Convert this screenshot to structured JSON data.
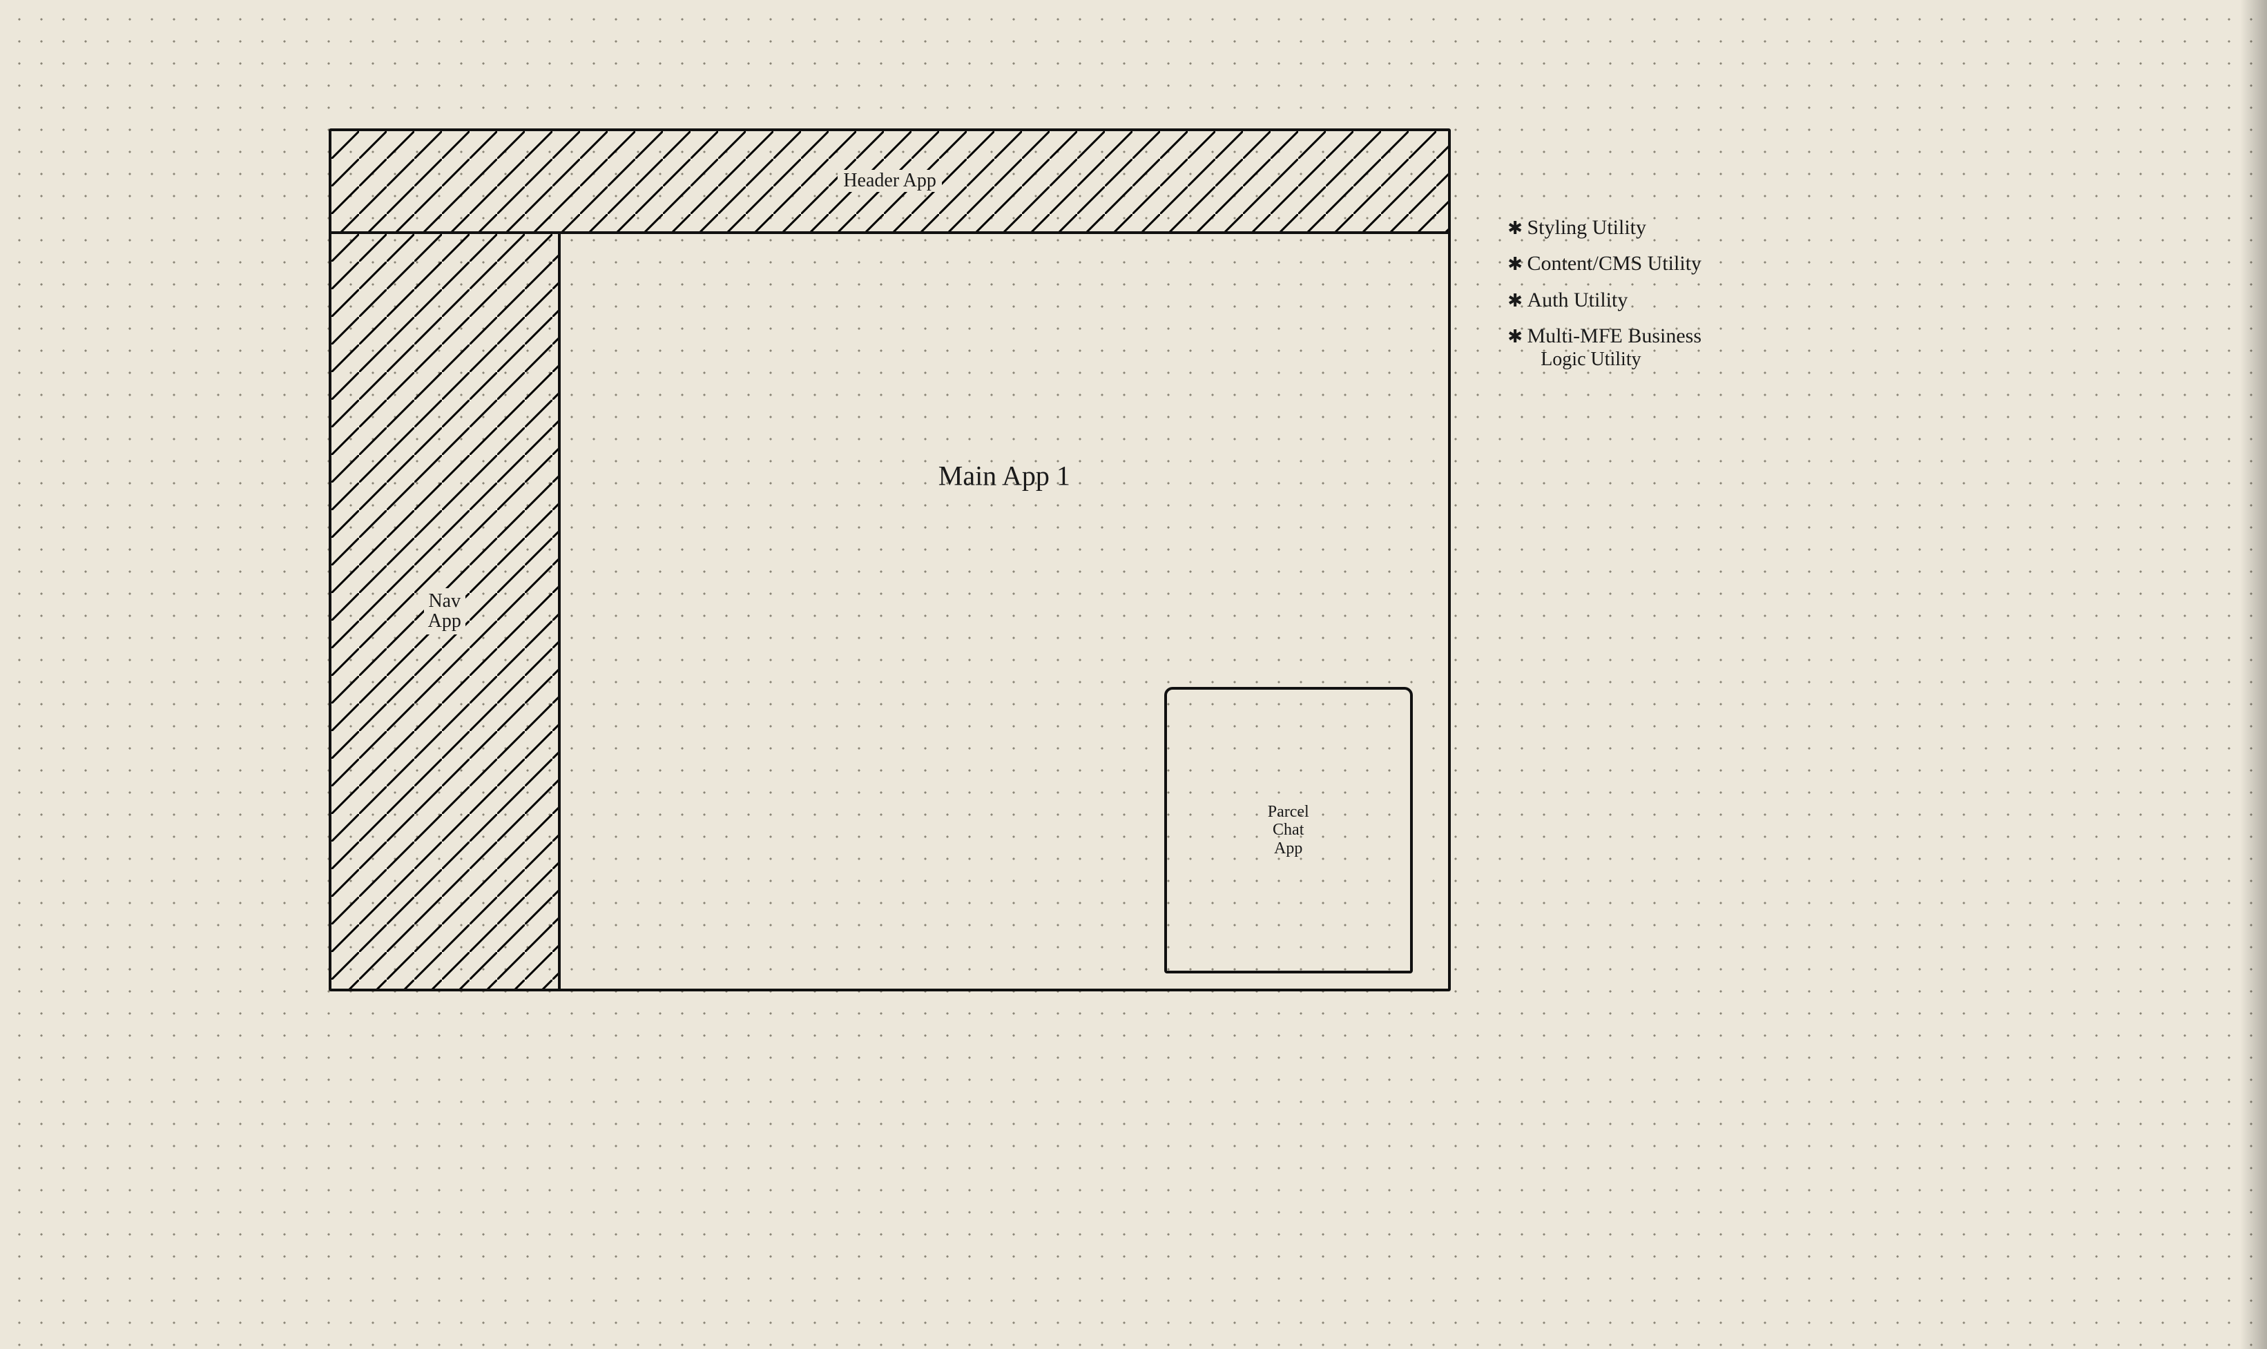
{
  "layout": {
    "header": {
      "label": "Header App"
    },
    "nav": {
      "label": "Nav\nApp"
    },
    "main": {
      "label": "Main App 1"
    },
    "parcel": {
      "label": "Parcel\nChat\nApp"
    }
  },
  "utilities": {
    "items": [
      {
        "label": "Styling Utility"
      },
      {
        "label": "Content/CMS Utility"
      },
      {
        "label": "Auth Utility"
      },
      {
        "label": "Multi-MFE Business",
        "label_line2": "Logic Utility"
      }
    ]
  }
}
